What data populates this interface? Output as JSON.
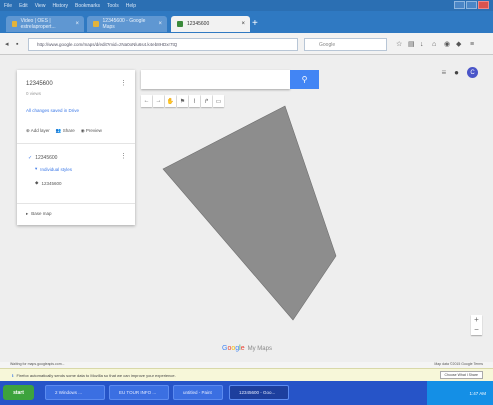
{
  "browser": {
    "menu": [
      "File",
      "Edit",
      "View",
      "History",
      "Bookmarks",
      "Tools",
      "Help"
    ],
    "tabs": [
      {
        "label": "Video | OES | estrelapropert..."
      },
      {
        "label": "12345600 - Google Maps"
      },
      {
        "label": "12345600"
      }
    ],
    "url": "http://www.google.com/maps/d/edit?mid=zNa0oNlu6s4.k4eb8HDxr7tQ",
    "search_placeholder": "Google"
  },
  "map_panel": {
    "title": "12345600",
    "views": "0 views",
    "all_changes": "All changes saved in Drive",
    "actions": [
      "Add layer",
      "Share",
      "Preview"
    ],
    "layer": {
      "name": "12345600",
      "style_link": "Individual styles",
      "item": "12345600"
    },
    "base_map": "Base map"
  },
  "map": {
    "search_value": "",
    "search_icon": "search-icon",
    "tools": [
      "undo-icon",
      "redo-icon",
      "hand-icon",
      "marker-icon",
      "shape-icon",
      "route-icon",
      "ruler-icon"
    ],
    "avatar_letter": "C",
    "polygon_color": "#8d8d8d",
    "logo_letters": [
      "G",
      "o",
      "o",
      "g",
      "l",
      "e"
    ],
    "logo_suffix": "My Maps"
  },
  "status": {
    "left": "Waiting for maps.googleapis.com...",
    "right": "Map data ©2015 Google  Terms"
  },
  "notice": {
    "text": "Firefox automatically sends some data to Mozilla so that we can improve your experience.",
    "button": "Choose What I Share"
  },
  "taskbar": {
    "start": "start",
    "tasks": [
      "2 Windows ...",
      "EU TOUR INFO ...",
      "untitled - Paint",
      "12345600 - Goo..."
    ],
    "clock": "1:47 AM"
  }
}
